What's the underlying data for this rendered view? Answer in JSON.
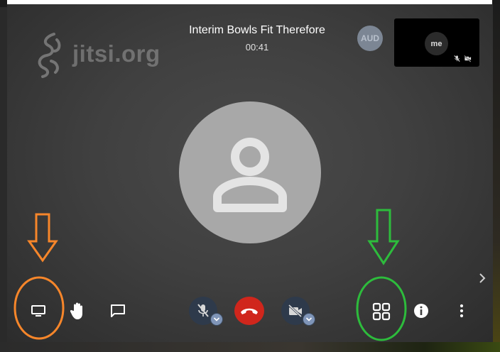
{
  "meeting": {
    "title": "Interim Bowls Fit Therefore",
    "duration": "00:41"
  },
  "watermark": {
    "brand": "jitsi.org"
  },
  "participants": {
    "remote_avatar_initials": "AUD",
    "local_label": "me"
  },
  "toolbar": {
    "left": [
      "screen-share",
      "raise-hand",
      "chat"
    ],
    "center": [
      "microphone-muted",
      "hangup",
      "camera-off"
    ],
    "right": [
      "tile-view",
      "info",
      "more-options"
    ]
  },
  "colors": {
    "accent_orange": "#f7862a",
    "accent_green": "#2dbc3c",
    "hangup_red": "#d0261c"
  }
}
